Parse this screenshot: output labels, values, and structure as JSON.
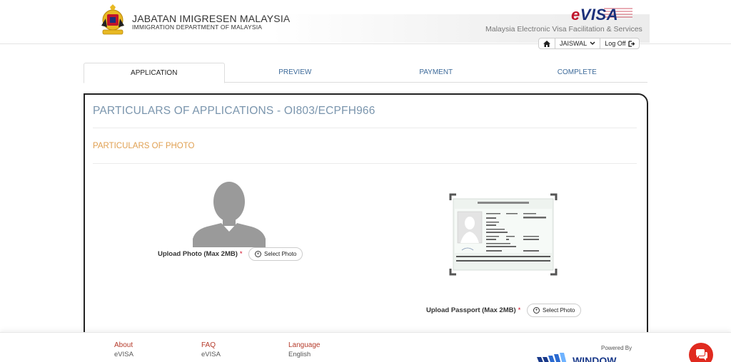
{
  "header": {
    "dept_title": "JABATAN IMIGRESEN MALAYSIA",
    "dept_subtitle": "IMMIGRATION DEPARTMENT OF MALAYSIA",
    "logo_text_e": "e",
    "logo_text_visa": "VISA",
    "tagline": "Malaysia Electronic Visa Facilitation & Services",
    "user": {
      "home_icon": "home-icon",
      "username": "JAISWAL",
      "logoff_label": "Log Off"
    }
  },
  "tabs": [
    {
      "label": "APPLICATION",
      "active": true
    },
    {
      "label": "PREVIEW",
      "active": false
    },
    {
      "label": "PAYMENT",
      "active": false
    },
    {
      "label": "COMPLETE",
      "active": false
    }
  ],
  "main": {
    "title": "PARTICULARS OF APPLICATIONS - OI803/ECPFH966",
    "section_title": "PARTICULARS OF PHOTO",
    "photo": {
      "label": "Upload Photo (Max 2MB)",
      "required_mark": "*",
      "button_label": "Select Photo"
    },
    "passport": {
      "label": "Upload Passport (Max 2MB)",
      "required_mark": "*",
      "button_label": "Select Photo",
      "sample": {
        "country": "REPUBLIC OF INDIA",
        "passport_no": "F7823033",
        "mrz1": "P<INDDEDHIA<<BHAVIKA<JITEN<<<<<<<<<<<<<<<<<<",
        "mrz2": "F7823033<0IND7501171F1609222<<<<<<<<<<<<<<<<"
      }
    }
  },
  "footer": {
    "columns": [
      {
        "heading": "About",
        "item": "eVISA"
      },
      {
        "heading": "FAQ",
        "item": "eVISA"
      },
      {
        "heading": "Language",
        "item": "English"
      }
    ],
    "powered_by": "Powered By",
    "brand": "WINDOW"
  },
  "colors": {
    "tab_link": "#3e6b9a",
    "title": "#7a95ad",
    "section": "#e0a052",
    "footer_heading": "#b53a2a",
    "chat": "#e02a1f"
  }
}
